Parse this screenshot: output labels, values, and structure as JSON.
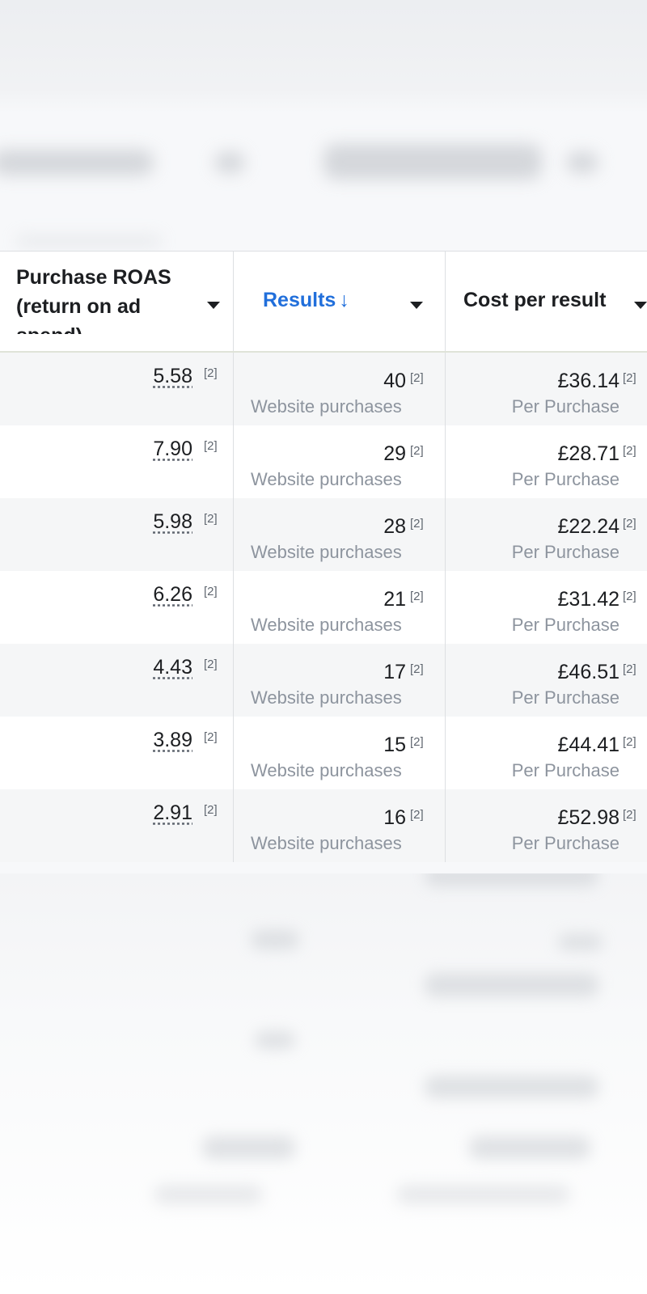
{
  "table": {
    "columns": {
      "roas": "Purchase ROAS (return on ad spend)",
      "results": "Results",
      "results_sort_indicator": "↓",
      "cost_per_result": "Cost per result"
    },
    "rows": [
      {
        "roas": "5.58",
        "roas_note": "[2]",
        "results": "40",
        "results_note": "[2]",
        "results_label": "Website purchases",
        "cost": "£36.14",
        "cost_note": "[2]",
        "cost_label": "Per Purchase"
      },
      {
        "roas": "7.90",
        "roas_note": "[2]",
        "results": "29",
        "results_note": "[2]",
        "results_label": "Website purchases",
        "cost": "£28.71",
        "cost_note": "[2]",
        "cost_label": "Per Purchase"
      },
      {
        "roas": "5.98",
        "roas_note": "[2]",
        "results": "28",
        "results_note": "[2]",
        "results_label": "Website purchases",
        "cost": "£22.24",
        "cost_note": "[2]",
        "cost_label": "Per Purchase"
      },
      {
        "roas": "6.26",
        "roas_note": "[2]",
        "results": "21",
        "results_note": "[2]",
        "results_label": "Website purchases",
        "cost": "£31.42",
        "cost_note": "[2]",
        "cost_label": "Per Purchase"
      },
      {
        "roas": "4.43",
        "roas_note": "[2]",
        "results": "17",
        "results_note": "[2]",
        "results_label": "Website purchases",
        "cost": "£46.51",
        "cost_note": "[2]",
        "cost_label": "Per Purchase"
      },
      {
        "roas": "3.89",
        "roas_note": "[2]",
        "results": "15",
        "results_note": "[2]",
        "results_label": "Website purchases",
        "cost": "£44.41",
        "cost_note": "[2]",
        "cost_label": "Per Purchase"
      },
      {
        "roas": "2.91",
        "roas_note": "[2]",
        "results": "16",
        "results_note": "[2]",
        "results_label": "Website purchases",
        "cost": "£52.98",
        "cost_note": "[2]",
        "cost_label": "Per Purchase"
      }
    ]
  },
  "colors": {
    "sorted_column_header": "#216fdb",
    "row_stripe": "#f5f6f7",
    "secondary_text": "#8d949e"
  },
  "icons": {
    "column_menu": "caret-down-icon",
    "sort": "arrow-down-icon"
  }
}
